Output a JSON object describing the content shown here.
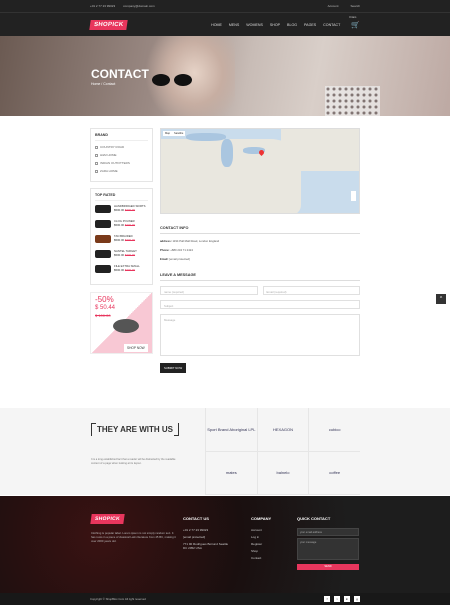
{
  "topbar": {
    "phone": "+01 2 77 23 99023",
    "email": "company@domain.com",
    "account": "Account",
    "search": "Search"
  },
  "header": {
    "logo": "SHOPICK",
    "nav": [
      "HOME",
      "MENS",
      "WOMENS",
      "SHOP",
      "BLOG",
      "PAGES",
      "CONTACT"
    ],
    "cart_label": "0 item"
  },
  "hero": {
    "title": "CONTACT",
    "crumb": "Home / Contact"
  },
  "brand_filter": {
    "title": "BRAND",
    "items": [
      "COUNTRY ROAD",
      "H&M HOME",
      "INDIAN OUTFITTERS",
      "ZARA HOME"
    ]
  },
  "top_rated": {
    "title": "TOP RATED",
    "products": [
      {
        "name": "HANDBRIDGED SKIRTS",
        "price": "$500.00",
        "old": "$300.00"
      },
      {
        "name": "CLOG POUNER",
        "price": "$500.00",
        "old": "$300.00"
      },
      {
        "name": "TAN BRAIDED",
        "price": "$500.00",
        "old": "$300.00"
      },
      {
        "name": "NANTEL TARGET",
        "price": "$500.00",
        "old": "$300.00"
      },
      {
        "name": "FILE EXTRA SMALL",
        "price": "$500.00",
        "old": "$300.00"
      }
    ]
  },
  "promo": {
    "percent": "-50%",
    "price": "$ 50.44",
    "old": "$ 100.00",
    "button": "SHOP NOW"
  },
  "map": {
    "tab_map": "Map",
    "tab_sat": "Satellite"
  },
  "contact_info": {
    "title": "CONTACT INFO",
    "address_label": "address:",
    "address": "1194 Pall Mall Road, London England",
    "phone_label": "Phone:",
    "phone": "+880 234 71 2424",
    "email_label": "Email:",
    "email": "[email protected]"
  },
  "form": {
    "title": "LEAVE A MESSAGE",
    "name_ph": "name (required)",
    "email_ph": "Email (required)",
    "subject_ph": "Subject",
    "message_ph": "Message",
    "send": "SUBMIT NOW"
  },
  "brands": {
    "title": "THEY ARE WITH US",
    "text": "It is a long established fact that a reader will be distracted by the readable content of a page when looking at its layout.",
    "logos": [
      "Sport Brand Aboriginal LPL",
      "HEXAGON",
      "cubico",
      "mates",
      "balnelo",
      "coffee"
    ]
  },
  "footer": {
    "logo": "SHOPICK",
    "about": "Clothing is popular label. Lorem ipsum is not simply random text. It has roots in a piece of classical Latin literature from 45 BC, making it over 2000 years old.",
    "contact_title": "CONTACT US",
    "contact": [
      "+01 2 77 23 99023",
      "[email protected]",
      "771 90 Rodrigues Boriund Seattle DC 2052 USA"
    ],
    "company_title": "COMPANY",
    "company": [
      "Account",
      "Log in",
      "Register",
      "Shop",
      "Contact"
    ],
    "quick_title": "QUICK CONTACT",
    "quick_email": "your email address",
    "quick_msg": "your message",
    "quick_send": "SEND",
    "copyright": "Copyright © ShopBloc.Com All right reserved",
    "social": [
      "f",
      "t",
      "in",
      "g"
    ]
  }
}
